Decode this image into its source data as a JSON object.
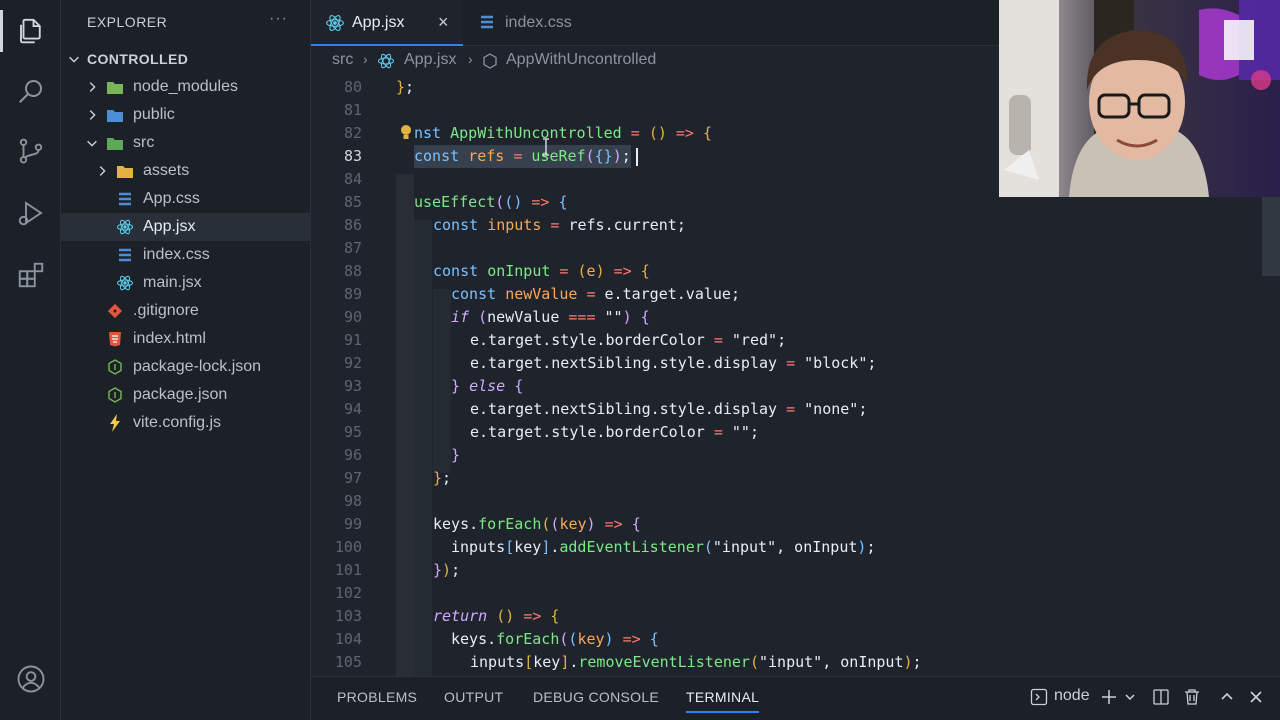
{
  "sidebar": {
    "title": "EXPLORER",
    "more": "···",
    "section": "CONTROLLED",
    "items": [
      {
        "label": "node_modules"
      },
      {
        "label": "public"
      },
      {
        "label": "src"
      },
      {
        "label": "assets"
      },
      {
        "label": "App.css"
      },
      {
        "label": "App.jsx"
      },
      {
        "label": "index.css"
      },
      {
        "label": "main.jsx"
      },
      {
        "label": ".gitignore"
      },
      {
        "label": "index.html"
      },
      {
        "label": "package-lock.json"
      },
      {
        "label": "package.json"
      },
      {
        "label": "vite.config.js"
      }
    ]
  },
  "tabs": [
    {
      "label": "App.jsx",
      "close": "×"
    },
    {
      "label": "index.css"
    }
  ],
  "breadcrumb": [
    "src",
    "App.jsx",
    "AppWithUncontrolled"
  ],
  "editor": {
    "line_numbers": [
      "80",
      "81",
      "82",
      "83",
      "84",
      "85",
      "86",
      "87",
      "88",
      "89",
      "90",
      "91",
      "92",
      "93",
      "94",
      "95",
      "96",
      "97",
      "98",
      "99",
      "100",
      "101",
      "102",
      "103",
      "104",
      "105"
    ]
  },
  "panel": {
    "tabs": [
      "PROBLEMS",
      "OUTPUT",
      "DEBUG CONSOLE",
      "TERMINAL"
    ],
    "terminal_name": "node"
  },
  "colors": {
    "accent": "#2f81f7",
    "react_icon": "#5ec8e5",
    "css_icon": "#4d8fd6"
  },
  "icons": {
    "activity": [
      "files-icon",
      "search-icon",
      "source-control-icon",
      "run-debug-icon",
      "extensions-icon",
      "account-icon"
    ]
  }
}
